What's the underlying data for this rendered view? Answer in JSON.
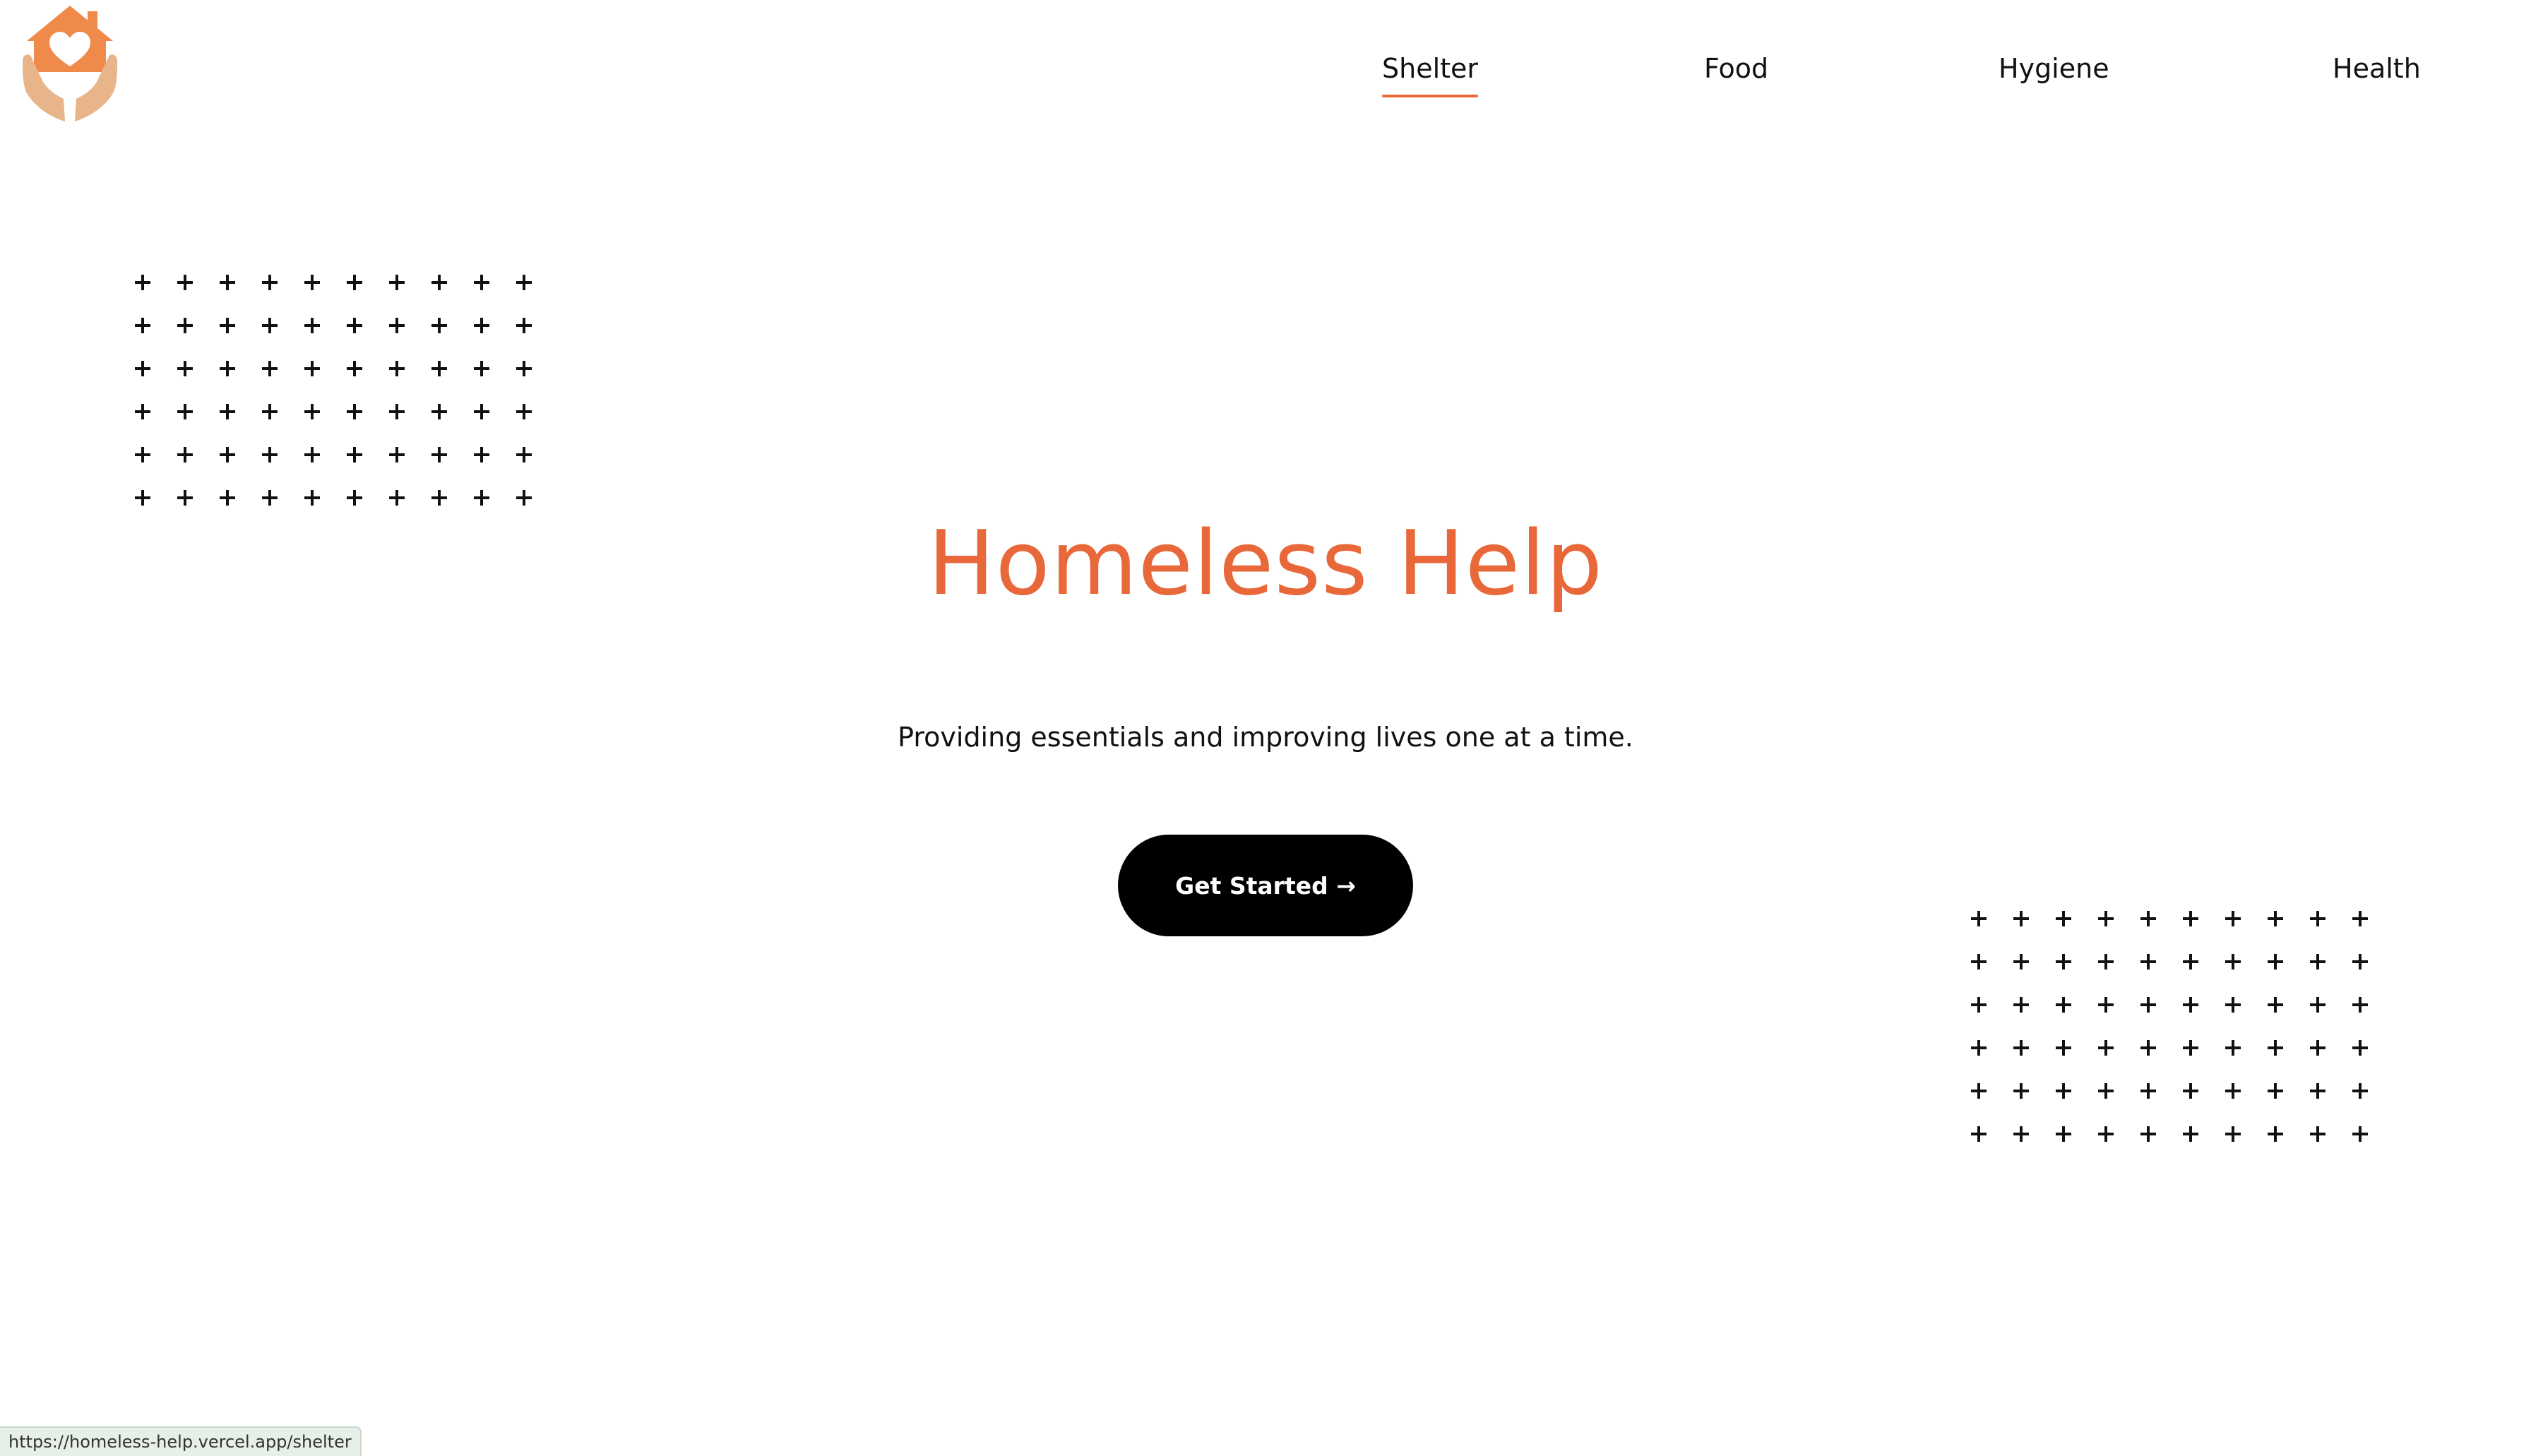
{
  "brand": {
    "logo_icon": "house-heart-hands-icon",
    "colors": {
      "accent": "#e8683a",
      "logo_orange": "#f08a4b",
      "logo_tan": "#e8b48a",
      "text": "#111111",
      "button_bg": "#000000",
      "button_text": "#ffffff"
    }
  },
  "nav": {
    "items": [
      {
        "label": "Shelter",
        "active": true
      },
      {
        "label": "Food",
        "active": false
      },
      {
        "label": "Hygiene",
        "active": false
      },
      {
        "label": "Health",
        "active": false
      }
    ]
  },
  "hero": {
    "title": "Homeless Help",
    "subtitle": "Providing essentials and improving lives one at a time.",
    "cta_label": "Get Started →"
  },
  "decorations": {
    "plus_icon": "plus-icon",
    "plus_grid_columns": 10,
    "plus_grid_rows": 6
  },
  "status_bar": {
    "url": "https://homeless-help.vercel.app/shelter"
  }
}
